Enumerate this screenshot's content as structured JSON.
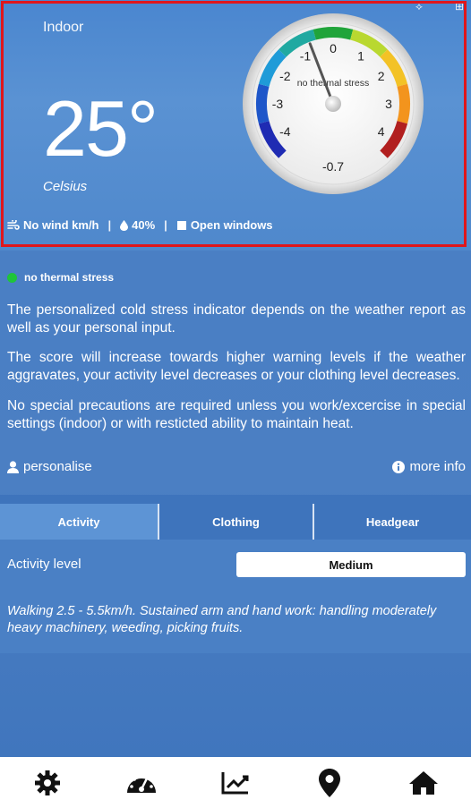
{
  "hero": {
    "location": "Indoor",
    "temperature": "25°",
    "unit": "Celsius",
    "wind": "No wind km/h",
    "humidity": "40%",
    "ventilation": "Open windows",
    "sep": "|"
  },
  "gauge": {
    "center_label": "no thermal stress",
    "value": -0.7,
    "value_label": "-0.7",
    "scale": [
      "-4",
      "-3",
      "-2",
      "-1",
      "0",
      "1",
      "2",
      "3",
      "4"
    ],
    "colors": [
      "#1f2bb3",
      "#1e56c9",
      "#1f9bd8",
      "#20a9a1",
      "#20a43a",
      "#b9d830",
      "#f3c226",
      "#f3941d",
      "#b11f1f"
    ]
  },
  "status": {
    "label": "no thermal stress",
    "color": "#1fc43a"
  },
  "info": {
    "p1": "The personalized cold stress indicator depends on the weather report as well as your personal input.",
    "p2": "The score will increase towards higher warning levels if the weather aggravates, your activity level decreases or your clothing level decreases.",
    "p3": "No special precautions are required unless you work/excercise in special settings (indoor) or with resticted ability to maintain heat."
  },
  "links": {
    "personalise": "personalise",
    "more_info": "more info"
  },
  "tabs": [
    {
      "label": "Activity"
    },
    {
      "label": "Clothing"
    },
    {
      "label": "Headgear"
    }
  ],
  "activity": {
    "label": "Activity level",
    "selected": "Medium",
    "description": "Walking 2.5 - 5.5km/h. Sustained arm and hand work: handling moderately heavy machinery, weeding, picking fruits."
  },
  "nav": [
    {
      "icon": "gear-icon"
    },
    {
      "icon": "gauge-icon"
    },
    {
      "icon": "chart-icon"
    },
    {
      "icon": "location-pin-icon"
    },
    {
      "icon": "home-icon"
    }
  ]
}
